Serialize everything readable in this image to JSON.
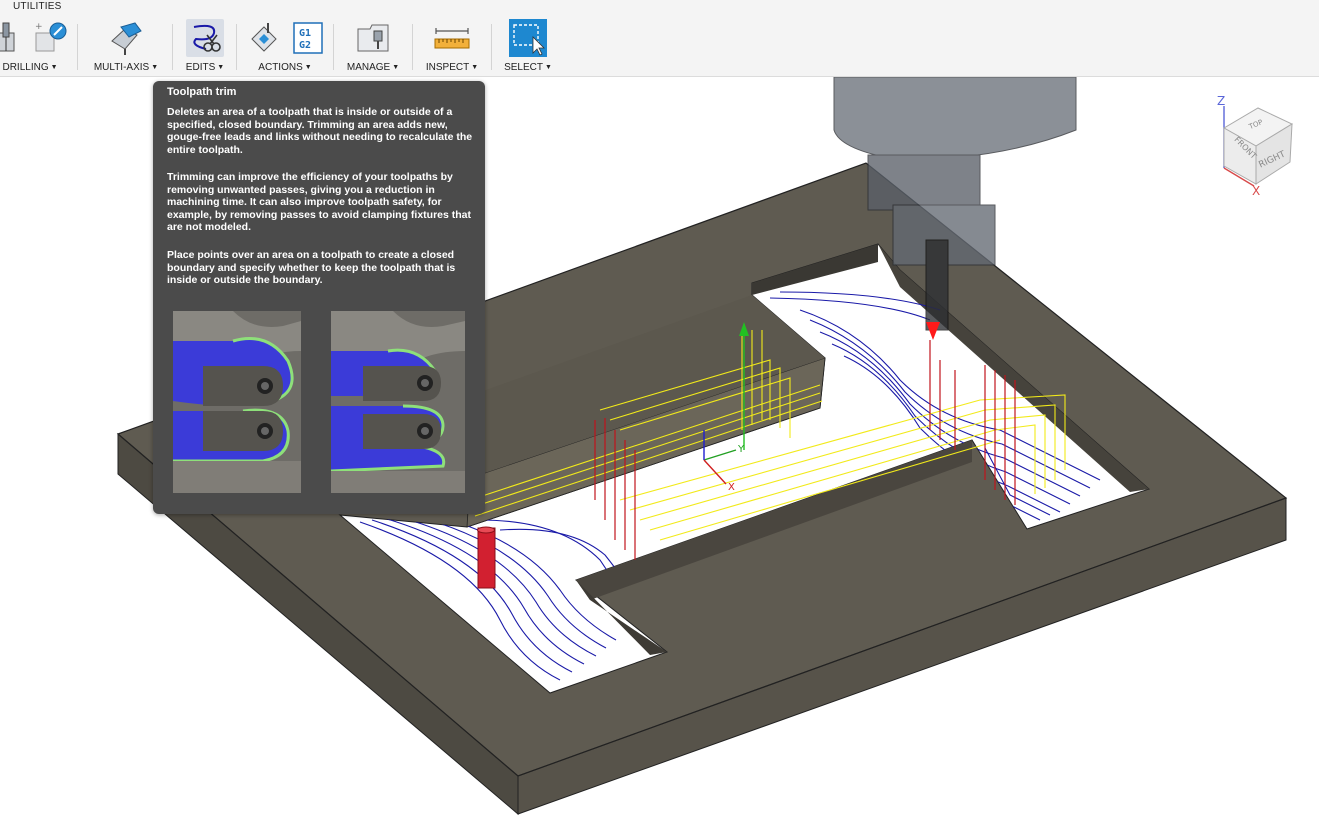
{
  "toolbar": {
    "tab_label": "UTILITIES",
    "groups": [
      {
        "label": "DRILLING",
        "caret": "▼"
      },
      {
        "label": "MULTI-AXIS",
        "caret": "▼"
      },
      {
        "label": "EDITS",
        "caret": "▼"
      },
      {
        "label": "ACTIONS",
        "caret": "▼"
      },
      {
        "label": "MANAGE",
        "caret": "▼"
      },
      {
        "label": "INSPECT",
        "caret": "▼"
      },
      {
        "label": "SELECT",
        "caret": "▼"
      }
    ],
    "g1g2_text": [
      "G1",
      "G2"
    ]
  },
  "tooltip": {
    "title": "Toolpath trim",
    "p1": "Deletes an area of a toolpath that is inside or outside of a specified, closed boundary. Trimming an area adds new, gouge-free leads and links without needing to recalculate the entire toolpath.",
    "p2": "Trimming can improve the efficiency of your toolpaths by removing unwanted passes, giving you a reduction in machining time. It can also improve toolpath safety, for example, by removing passes to avoid clamping fixtures that are not modeled.",
    "p3": "Place points over an area on a toolpath to create a closed boundary and specify whether to keep the toolpath that is inside or outside the boundary."
  },
  "viewcube": {
    "top": "TOP",
    "front": "FRONT",
    "right": "RIGHT",
    "z": "Z",
    "x": "X"
  },
  "triad": {
    "y": "Y",
    "x": "X"
  },
  "colors": {
    "select_blue": "#1e88d0",
    "toolpath_blue": "#1a1aa8",
    "toolpath_yellow": "#f2ea1a",
    "toolpath_red": "#c0141c",
    "stock": "#5f5b51",
    "tooltip_bg": "#4b4b4b"
  }
}
